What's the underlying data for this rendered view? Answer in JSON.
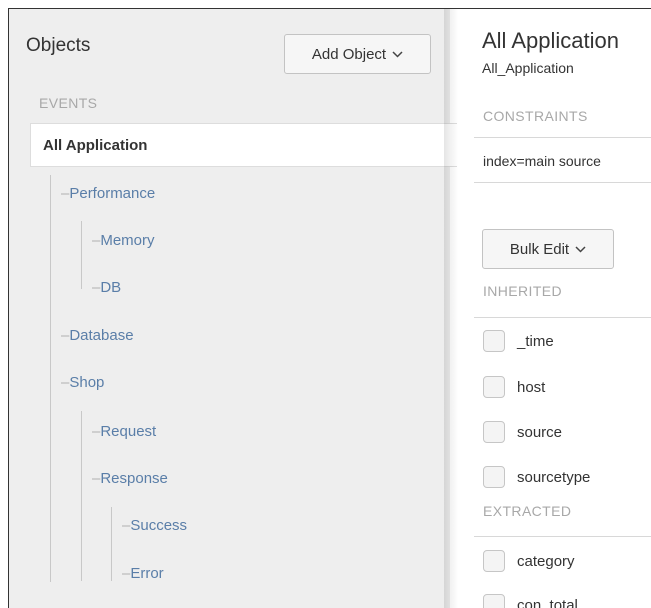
{
  "sidebar": {
    "title": "Objects",
    "add_button_label": "Add Object",
    "section_label": "EVENTS",
    "selected_item": "All Application",
    "tree": [
      "Performance",
      "Memory",
      "DB",
      "Database",
      "Shop",
      "Request",
      "Response",
      "Success",
      "Error"
    ]
  },
  "main": {
    "title": "All Application",
    "subtitle": "All_Application",
    "constraints_label": "CONSTRAINTS",
    "constraint_value": "index=main source",
    "bulk_edit_label": "Bulk Edit",
    "inherited_label": "INHERITED",
    "inherited_fields": [
      "_time",
      "host",
      "source",
      "sourcetype"
    ],
    "extracted_label": "EXTRACTED",
    "extracted_fields": [
      "category",
      "con_total"
    ]
  },
  "icons": {
    "dropdown": "chevron-down-icon",
    "tree_connector": "dash"
  }
}
